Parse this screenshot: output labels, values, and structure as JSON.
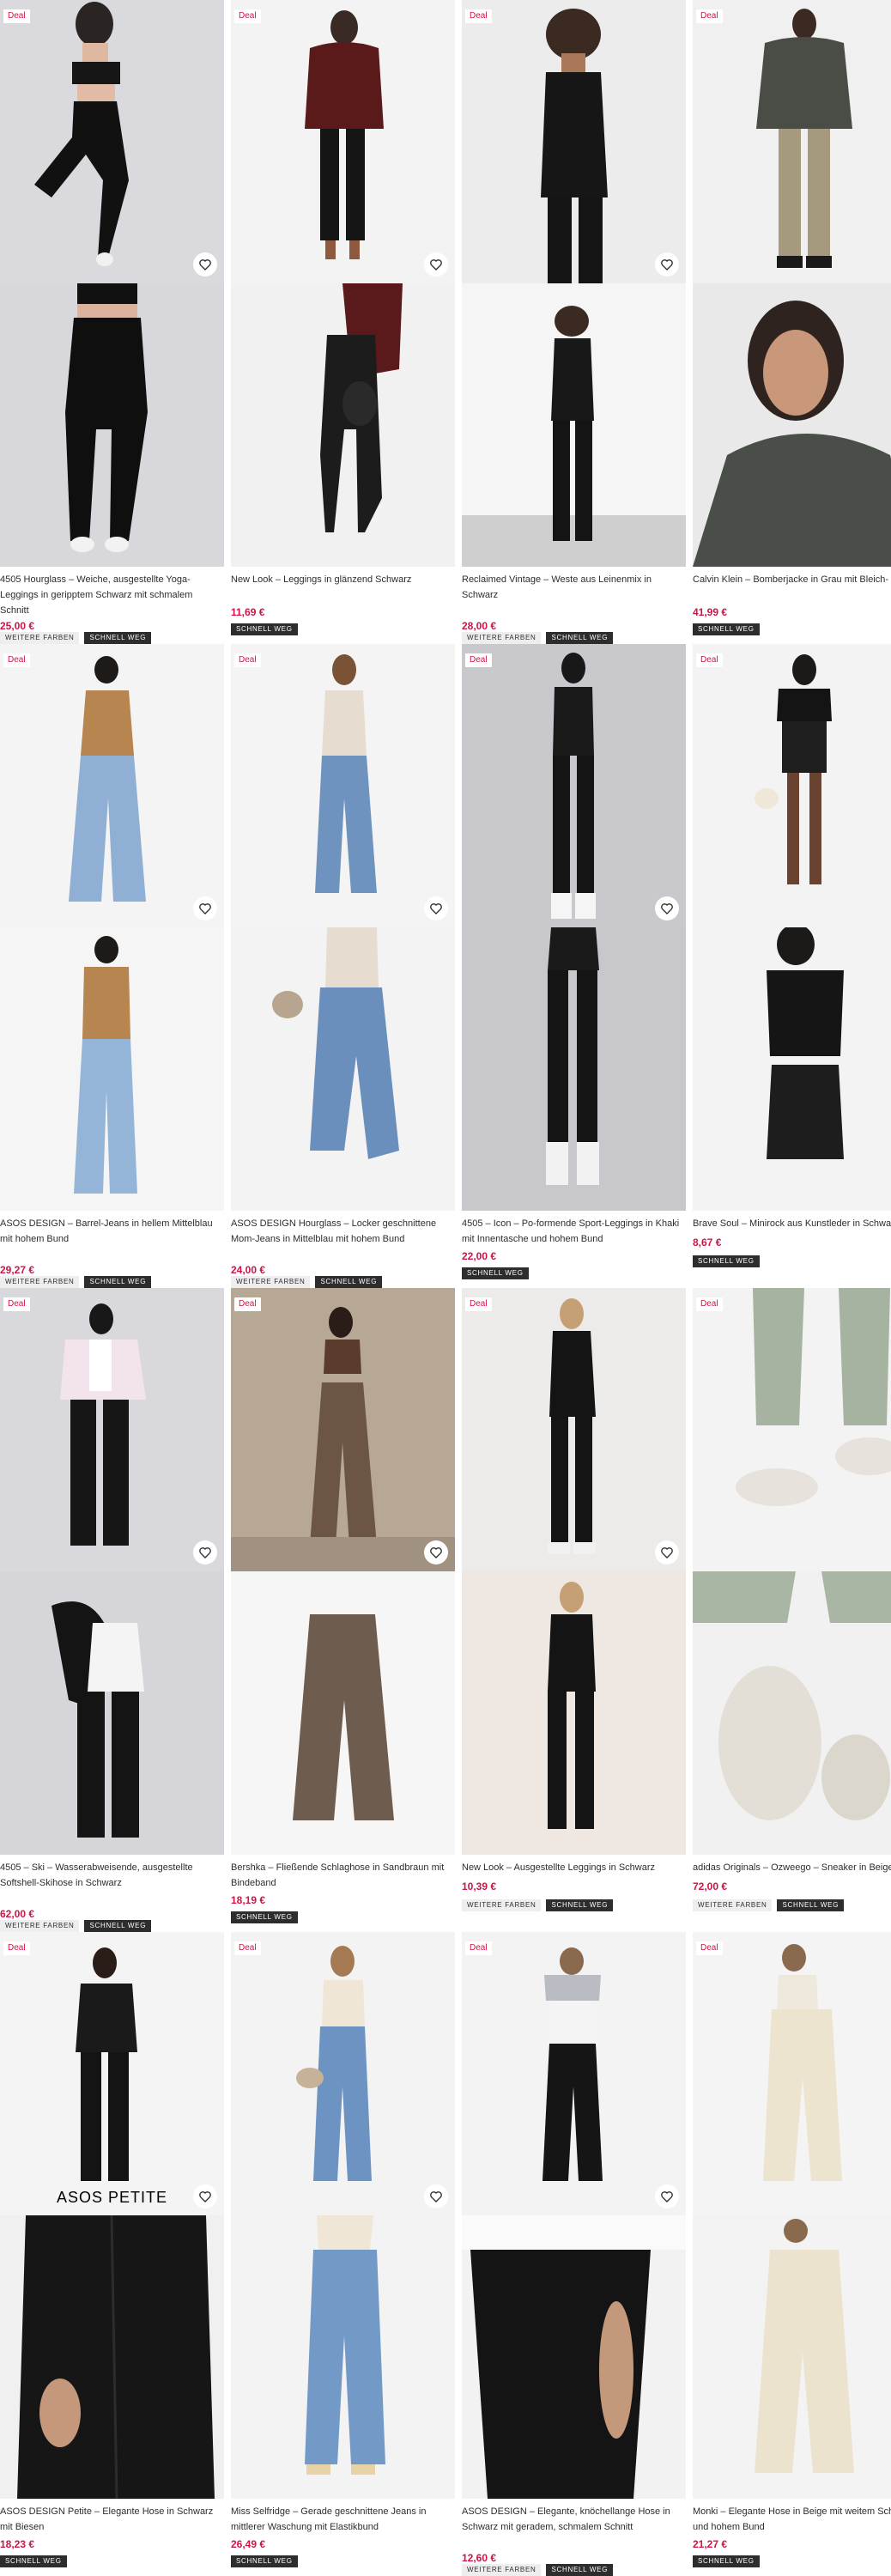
{
  "colors": {
    "deal": "#d01345",
    "price": "#d01345",
    "tag_dark_bg": "#2d2d2d",
    "tag_light_bg": "#eeeeee"
  },
  "icons": {
    "favourite": "heart-icon"
  },
  "labels": {
    "deal": "Deal",
    "more_colours": "WEITERE FARBEN",
    "fast_shipping": "SCHNELL WEG",
    "asos_petite_logo": "ASOS PETITE"
  },
  "products": [
    {
      "title": "4505 Hourglass – Weiche, ausgestellte Yoga-Leggings in geripptem Schwarz mit schmalem Schnitt",
      "price": "25,00 €",
      "deal": true,
      "more_colours": true,
      "fast_shipping": true
    },
    {
      "title": "New Look – Leggings in glänzend Schwarz",
      "price": "11,69 €",
      "deal": true,
      "more_colours": false,
      "fast_shipping": true
    },
    {
      "title": "Reclaimed Vintage – Weste aus Leinenmix in Schwarz",
      "price": "28,00 €",
      "deal": true,
      "more_colours": true,
      "fast_shipping": true
    },
    {
      "title": "Calvin Klein – Bomberjacke in Grau mit Bleich-",
      "price": "41,99 €",
      "deal": true,
      "more_colours": false,
      "fast_shipping": true
    },
    {
      "title": "ASOS DESIGN – Barrel-Jeans in hellem Mittelblau mit hohem Bund",
      "price": "29,27 €",
      "deal": true,
      "more_colours": true,
      "fast_shipping": true
    },
    {
      "title": "ASOS DESIGN Hourglass – Locker geschnittene Mom-Jeans in Mittelblau mit hohem Bund",
      "price": "24,00 €",
      "deal": true,
      "more_colours": true,
      "fast_shipping": true
    },
    {
      "title": "4505 – Icon – Po-formende Sport-Leggings in Khaki mit Innentasche und hohem Bund",
      "price": "22,00 €",
      "deal": true,
      "more_colours": false,
      "fast_shipping": true
    },
    {
      "title": "Brave Soul – Minirock aus Kunstleder in Schwarz",
      "price": "8,67 €",
      "deal": true,
      "more_colours": false,
      "fast_shipping": true
    },
    {
      "title": "4505 – Ski – Wasserabweisende, ausgestellte Softshell-Skihose in Schwarz",
      "price": "62,00 €",
      "deal": true,
      "more_colours": true,
      "fast_shipping": true
    },
    {
      "title": "Bershka – Fließende Schlaghose in Sandbraun mit Bindeband",
      "price": "18,19 €",
      "deal": true,
      "more_colours": false,
      "fast_shipping": true
    },
    {
      "title": "New Look – Ausgestellte Leggings in Schwarz",
      "price": "10,39 €",
      "deal": true,
      "more_colours": true,
      "fast_shipping": true
    },
    {
      "title": "adidas Originals – Ozweego – Sneaker in Beige",
      "price": "72,00 €",
      "deal": true,
      "more_colours": true,
      "fast_shipping": true
    },
    {
      "title": "ASOS DESIGN Petite – Elegante Hose in Schwarz mit Biesen",
      "price": "18,23 €",
      "deal": true,
      "more_colours": false,
      "fast_shipping": true
    },
    {
      "title": "Miss Selfridge – Gerade geschnittene Jeans in mittlerer Waschung mit Elastikbund",
      "price": "26,49 €",
      "deal": true,
      "more_colours": false,
      "fast_shipping": true
    },
    {
      "title": "ASOS DESIGN – Elegante, knöchellange Hose in Schwarz mit geradem, schmalem Schnitt",
      "price": "12,60 €",
      "deal": true,
      "more_colours": true,
      "fast_shipping": true
    },
    {
      "title": "Monki – Elegante Hose in Beige mit weitem Schnitt und hohem Bund",
      "price": "21,27 €",
      "deal": true,
      "more_colours": false,
      "fast_shipping": true
    }
  ]
}
